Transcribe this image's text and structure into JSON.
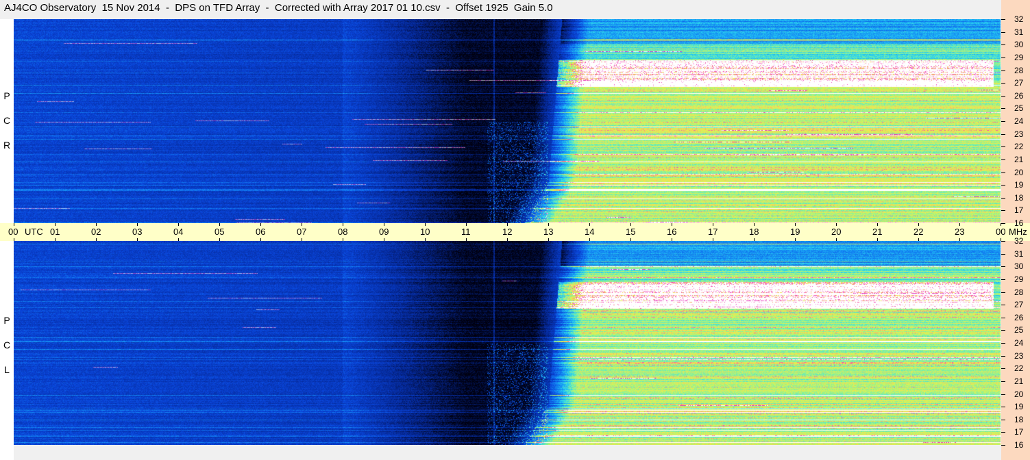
{
  "title": "AJ4CO Observatory  15 Nov 2014  -  DPS on TFD Array  -  Corrected with Array 2017 01 10.csv  -  Offset 1925  Gain 5.0",
  "panels": [
    {
      "id": "rcp",
      "label_letters": [
        "P",
        "C",
        "R"
      ]
    },
    {
      "id": "lcp",
      "label_letters": [
        "P",
        "C",
        "L"
      ]
    }
  ],
  "time_axis": {
    "labels": [
      "00",
      "UTC",
      "01",
      "02",
      "03",
      "04",
      "05",
      "06",
      "07",
      "08",
      "09",
      "10",
      "11",
      "12",
      "13",
      "14",
      "15",
      "16",
      "17",
      "18",
      "19",
      "20",
      "21",
      "22",
      "23",
      "00",
      "MHz"
    ]
  },
  "freq_axis": {
    "labels": [
      "32",
      "31",
      "30",
      "29",
      "28",
      "27",
      "26",
      "25",
      "24",
      "23",
      "22",
      "21",
      "20",
      "19",
      "18",
      "17",
      "16"
    ]
  },
  "colors": {
    "background": "#f0f0f0",
    "time_axis_bg": "#ffffc8",
    "freq_axis_bg": "#fcd9bf",
    "night_dark": "#000010",
    "deep_blue": "#0a3fd0",
    "cyan": "#30e0f0",
    "yellow_green": "#d0f060",
    "white": "#ffffff",
    "magenta": "#e020c0"
  }
}
